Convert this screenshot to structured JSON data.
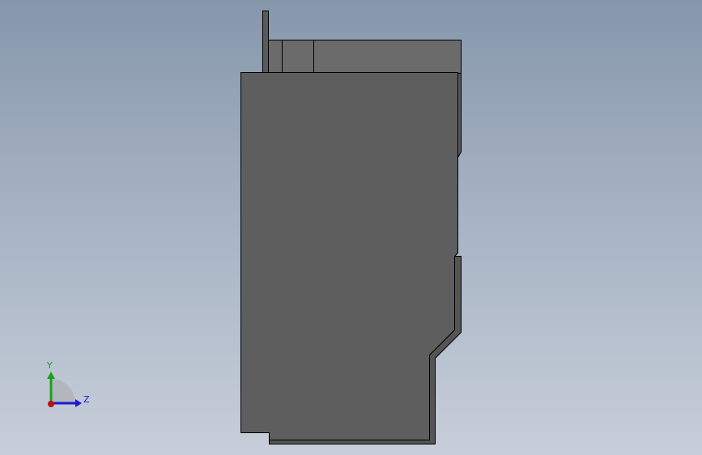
{
  "viewport": {
    "background_top": "#8697ab",
    "background_bottom": "#c7ced9"
  },
  "model": {
    "body_fill": "#5e5e5e",
    "top_fill": "#6b6b6b",
    "flange_fill": "#555555",
    "edge_color": "#000000"
  },
  "triad": {
    "y_label": "Y",
    "z_label": "Z",
    "y_color": "#1aa01a",
    "z_color": "#1a1ad0",
    "x_color": "#c01010"
  }
}
